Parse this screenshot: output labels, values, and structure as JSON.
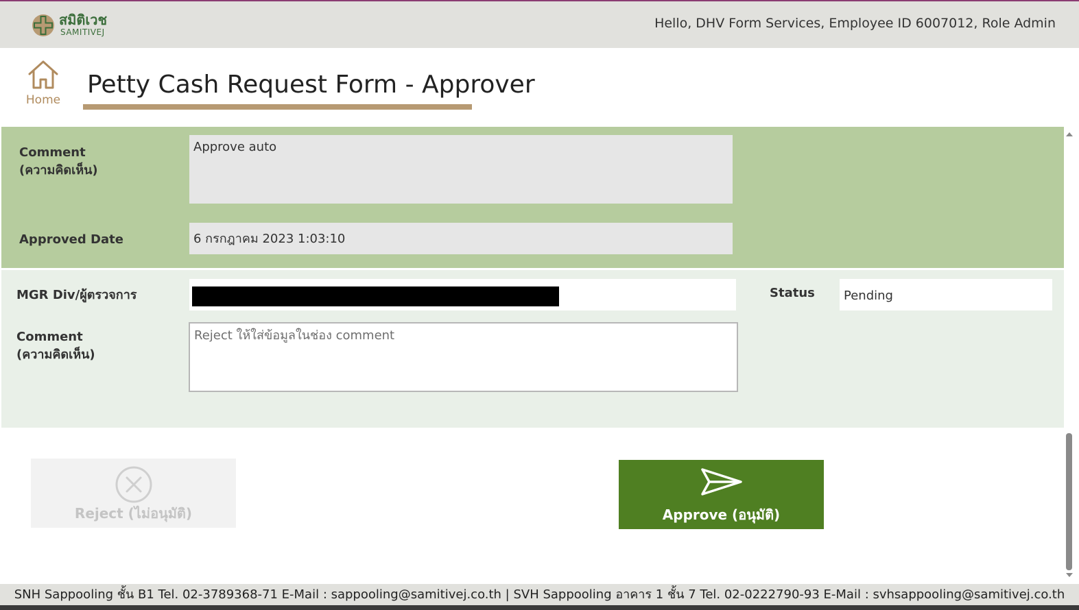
{
  "header": {
    "logo_thai": "สมิติเวช",
    "logo_en": "SAMITIVEJ",
    "greeting": "Hello, DHV Form Services, Employee ID 6007012, Role Admin"
  },
  "nav": {
    "home_label": "Home"
  },
  "page": {
    "title": "Petty Cash Request Form - Approver"
  },
  "previous_approval": {
    "comment_label_line1": "Comment",
    "comment_label_line2": "(ความคิดเห็น)",
    "comment_value": "Approve auto",
    "approved_date_label": "Approved Date",
    "approved_date_value": "6 กรกฎาคม 2023 1:03:10"
  },
  "current_approval": {
    "approver_label": "MGR Div/ผู้ตรวจการ",
    "status_label": "Status",
    "status_value": "Pending",
    "comment_label_line1": "Comment",
    "comment_label_line2": "(ความคิดเห็น)",
    "comment_placeholder": "Reject ให้ใส่ข้อมูลในช่อง comment"
  },
  "actions": {
    "reject_label": "Reject (ไม่อนุมัติ)",
    "approve_label": "Approve (อนุมัติ)"
  },
  "footer": {
    "text": "SNH Sappooling ชั้น B1  Tel. 02-3789368-71  E-Mail : sappooling@samitivej.co.th | SVH Sappooling อาคาร 1 ชั้น 7  Tel. 02-0222790-93  E-Mail : svhsappooling@samitivej.co.th"
  },
  "colors": {
    "brand_green": "#4f7f22",
    "brand_gold": "#b79a73",
    "section_green": "#b6cc9e",
    "section_light": "#e9f0e8"
  }
}
